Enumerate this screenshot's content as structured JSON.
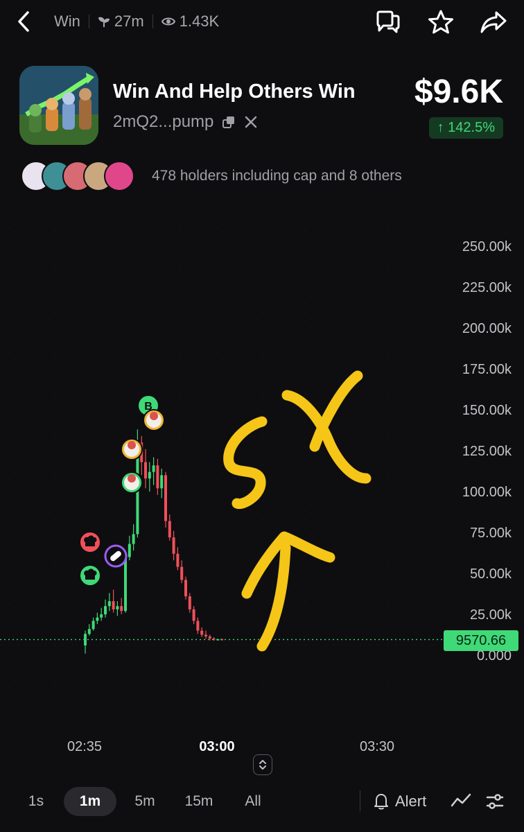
{
  "topbar": {
    "back_icon": "chevron-left-icon",
    "ticker": "Win",
    "age": "27m",
    "views": "1.43K",
    "actions": [
      "chat-bubbles-icon",
      "star-icon",
      "share-icon"
    ]
  },
  "token": {
    "name": "Win And Help Others Win",
    "address": "2mQ2...pump",
    "price": "$9.6K",
    "change": "↑ 142.5%"
  },
  "holders": {
    "text": "478 holders including cap and 8 others",
    "avatar_colors": [
      "#e8e3ee",
      "#3f8f96",
      "#d66b73",
      "#c9a77f",
      "#e0478a"
    ]
  },
  "chart_data": {
    "type": "candlestick",
    "y_ticks": [
      "250.00k",
      "225.00k",
      "200.00k",
      "175.00k",
      "150.00k",
      "125.00k",
      "100.00k",
      "75.00k",
      "50.00k",
      "25.00k",
      "0.000"
    ],
    "ylim": [
      0,
      250000
    ],
    "x_ticks": [
      "02:35",
      "03:00",
      "03:30"
    ],
    "x_ticks_bold": [
      false,
      true,
      false
    ],
    "current_price_label": "9570.66",
    "colors": {
      "up": "#3fd978",
      "down": "#f0505a"
    },
    "candles": [
      {
        "o": 6000,
        "h": 15000,
        "l": 1000,
        "c": 13000
      },
      {
        "o": 13000,
        "h": 19000,
        "l": 12000,
        "c": 16000
      },
      {
        "o": 16000,
        "h": 23000,
        "l": 15000,
        "c": 21000
      },
      {
        "o": 21000,
        "h": 26000,
        "l": 19000,
        "c": 23000
      },
      {
        "o": 23000,
        "h": 29000,
        "l": 21000,
        "c": 25000
      },
      {
        "o": 25000,
        "h": 34000,
        "l": 23000,
        "c": 30000
      },
      {
        "o": 30000,
        "h": 38000,
        "l": 27000,
        "c": 33000
      },
      {
        "o": 33000,
        "h": 40000,
        "l": 26000,
        "c": 28000
      },
      {
        "o": 28000,
        "h": 33000,
        "l": 24000,
        "c": 30000
      },
      {
        "o": 30000,
        "h": 35000,
        "l": 25000,
        "c": 27000
      },
      {
        "o": 27000,
        "h": 62000,
        "l": 26000,
        "c": 60000
      },
      {
        "o": 60000,
        "h": 73000,
        "l": 58000,
        "c": 68000
      },
      {
        "o": 68000,
        "h": 80000,
        "l": 64000,
        "c": 74000
      },
      {
        "o": 74000,
        "h": 138000,
        "l": 72000,
        "c": 130000
      },
      {
        "o": 130000,
        "h": 134000,
        "l": 110000,
        "c": 118000
      },
      {
        "o": 118000,
        "h": 126000,
        "l": 102000,
        "c": 108000
      },
      {
        "o": 108000,
        "h": 118000,
        "l": 100000,
        "c": 112000
      },
      {
        "o": 112000,
        "h": 121000,
        "l": 104000,
        "c": 116000
      },
      {
        "o": 116000,
        "h": 120000,
        "l": 98000,
        "c": 102000
      },
      {
        "o": 102000,
        "h": 114000,
        "l": 96000,
        "c": 110000
      },
      {
        "o": 110000,
        "h": 112000,
        "l": 78000,
        "c": 82000
      },
      {
        "o": 82000,
        "h": 86000,
        "l": 70000,
        "c": 72000
      },
      {
        "o": 72000,
        "h": 76000,
        "l": 58000,
        "c": 62000
      },
      {
        "o": 62000,
        "h": 66000,
        "l": 52000,
        "c": 54000
      },
      {
        "o": 54000,
        "h": 58000,
        "l": 44000,
        "c": 46000
      },
      {
        "o": 46000,
        "h": 48000,
        "l": 34000,
        "c": 36000
      },
      {
        "o": 36000,
        "h": 38000,
        "l": 26000,
        "c": 28000
      },
      {
        "o": 28000,
        "h": 30000,
        "l": 19000,
        "c": 21000
      },
      {
        "o": 21000,
        "h": 23000,
        "l": 13000,
        "c": 15000
      },
      {
        "o": 15000,
        "h": 17000,
        "l": 11000,
        "c": 12500
      },
      {
        "o": 12500,
        "h": 15000,
        "l": 10000,
        "c": 11500
      },
      {
        "o": 11500,
        "h": 12500,
        "l": 9000,
        "c": 10200
      },
      {
        "o": 10200,
        "h": 11000,
        "l": 8800,
        "c": 9600
      },
      {
        "o": 9600,
        "h": 10000,
        "l": 8900,
        "c": 9800
      },
      {
        "o": 9800,
        "h": 10100,
        "l": 9200,
        "c": 9570
      }
    ],
    "markers": [
      {
        "letter": "B",
        "color": "#3fd978"
      },
      {
        "icon": "avatar-icon",
        "color": "#f0b43a"
      },
      {
        "icon": "avatar-icon",
        "color": "#f0b43a"
      },
      {
        "icon": "avatar-icon",
        "color": "#3fd978"
      },
      {
        "icon": "chef-hat-icon",
        "color": "#f0505a"
      },
      {
        "icon": "pill-icon",
        "color": "#9b5cf6"
      },
      {
        "icon": "chef-hat-icon",
        "color": "#3fd978"
      }
    ]
  },
  "annotation": {
    "color": "#f5c518"
  },
  "timeframes": {
    "items": [
      "1s",
      "1m",
      "5m",
      "15m",
      "All"
    ],
    "active": "1m",
    "alert_label": "Alert"
  }
}
